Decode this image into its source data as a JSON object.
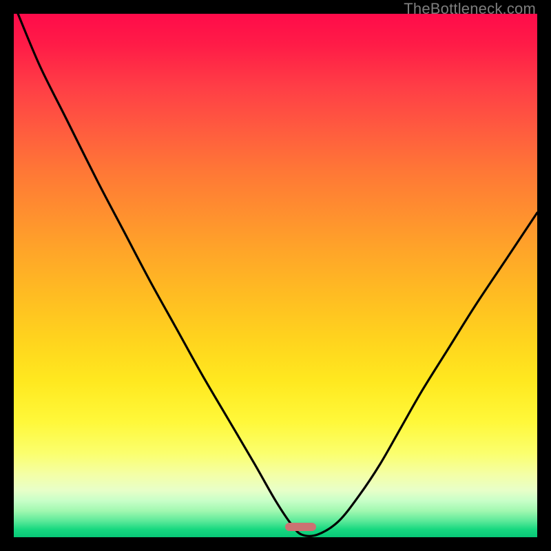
{
  "watermark": "TheBottleneck.com",
  "marker": {
    "x_frac": 0.548,
    "y_frac": 0.98,
    "w_frac": 0.06,
    "h_frac": 0.016,
    "color": "#cb7272"
  },
  "chart_data": {
    "type": "line",
    "title": "",
    "xlabel": "",
    "ylabel": "",
    "xlim": [
      0,
      100
    ],
    "ylim": [
      0,
      100
    ],
    "grid": false,
    "legend": false,
    "annotations": [
      "TheBottleneck.com"
    ],
    "background_gradient": [
      {
        "pos": 0.0,
        "color": "#ff0b4a"
      },
      {
        "pos": 0.5,
        "color": "#ffb024"
      },
      {
        "pos": 0.8,
        "color": "#fff94e"
      },
      {
        "pos": 0.93,
        "color": "#c8ffc8"
      },
      {
        "pos": 1.0,
        "color": "#08c877"
      }
    ],
    "series": [
      {
        "name": "bottleneck-curve",
        "stroke": "#000000",
        "x": [
          0.8,
          5,
          10,
          16,
          21,
          26,
          31,
          36,
          41,
          46,
          50,
          53,
          55,
          58,
          62,
          66,
          70,
          74,
          78,
          83,
          88,
          94,
          100
        ],
        "y": [
          100,
          90,
          80,
          68,
          58.5,
          49,
          40,
          31,
          22.5,
          14,
          7,
          2.5,
          0.5,
          0.5,
          3,
          8,
          14,
          21,
          28,
          36,
          44,
          53,
          62
        ]
      }
    ],
    "marker_region": {
      "x_center": 56.5,
      "width": 6,
      "y": 0.5
    }
  }
}
